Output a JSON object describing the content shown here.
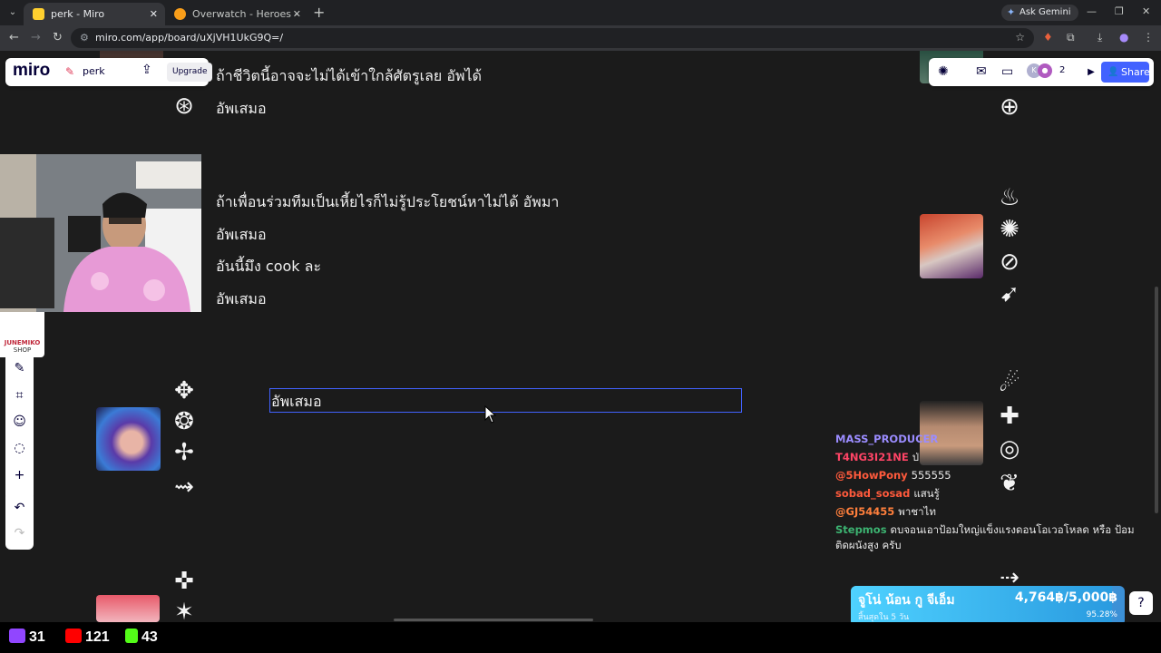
{
  "browser": {
    "tabs": [
      {
        "title": "perk - Miro",
        "active": true,
        "favicon_color": "#ffd02f"
      },
      {
        "title": "Overwatch - Heroes - Zenyatta",
        "active": false,
        "favicon_color": "#f99e1a"
      }
    ],
    "ask_gemini": "Ask Gemini",
    "url": "miro.com/app/board/uXjVH1UkG9Q=/"
  },
  "miro": {
    "logo": "miro",
    "board_name": "perk",
    "upgrade_label": "Upgrade",
    "collaborator_count": "2",
    "share_label": "Share",
    "accent_color": "#4262ff"
  },
  "board": {
    "lines": [
      "ถ้าชีวิตนี้อาจจะไม่ได้เข้าใกล้ศัตรูเลย อัพได้",
      "อัพเสมอ",
      "ถ้าเพื่อนร่วมทีมเป็นเหี้ยไรก็ไม่รู้ประโยชน์หาไม่ได้ อัพมา",
      "อัพเสมอ",
      "อันนี้มึง cook ละ",
      "อัพเสมอ"
    ],
    "editing_text": "อัพเสมอ"
  },
  "shop_logo": {
    "line1": "JUNEMIKO",
    "line2": "SHOP"
  },
  "chat": [
    {
      "user": "MASS_PRODUCER",
      "color": "#9b8cff",
      "message": ""
    },
    {
      "user": "T4NG3I21NE",
      "color": "#ff4466",
      "message": "ป่"
    },
    {
      "user": "@5HowPony",
      "color": "#ff5a3c",
      "message": "555555"
    },
    {
      "user": "sobad_sosad",
      "color": "#ff5a3c",
      "message": "แสนรู้"
    },
    {
      "user": "@GJ54455",
      "color": "#ff7f3c",
      "message": "พาชาไท"
    },
    {
      "user": "Stepmos",
      "color": "#3cb371",
      "message": "ดบจอนเอาป้อมใหญ่แข็งแรงดอนโอเวอโหลด หรือ ป้อมติดผนังสูง ครับ"
    }
  ],
  "donation": {
    "title": "จูโน่ น้อน กู จีเอ็ม",
    "subtitle": "สิ้นสุดใน 5 วัน",
    "amount": "4,764฿/5,000฿",
    "percent_label": "95.28%",
    "progress": 0.9528
  },
  "stream_stats": [
    {
      "platform": "twitch",
      "count": "31",
      "color": "#9146ff"
    },
    {
      "platform": "youtube",
      "count": "121",
      "color": "#ff0000"
    },
    {
      "platform": "kick",
      "count": "43",
      "color": "#53fc18"
    }
  ]
}
